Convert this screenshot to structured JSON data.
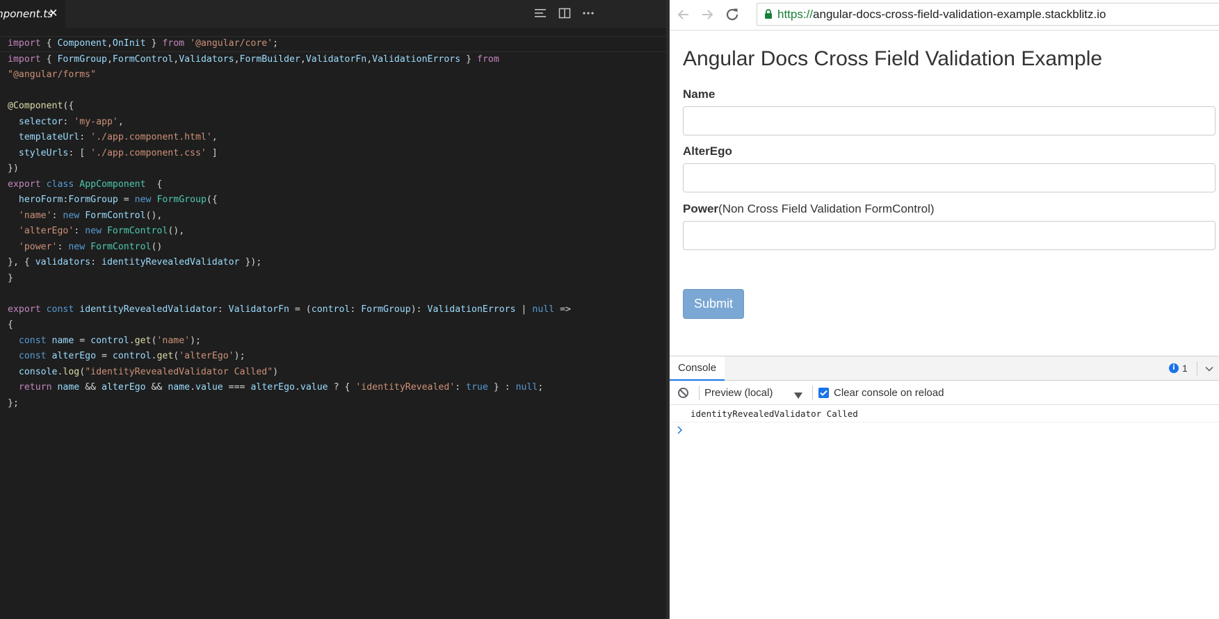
{
  "editor": {
    "tab_label": "app.component.ts",
    "tab_close": "✕",
    "icons": [
      "outline-icon",
      "split-editor-icon",
      "more-actions-icon"
    ],
    "code_lines": [
      [
        [
          "kw",
          "import"
        ],
        [
          "p",
          " { "
        ],
        [
          "ty",
          "Component"
        ],
        [
          "p",
          ","
        ],
        [
          "ty",
          "OnInit"
        ],
        [
          "p",
          " } "
        ],
        [
          "kw",
          "from"
        ],
        [
          "p",
          " "
        ],
        [
          "st",
          "'@angular/core'"
        ],
        [
          "p",
          ";"
        ]
      ],
      [
        [
          "kw",
          "import"
        ],
        [
          "p",
          " { "
        ],
        [
          "ty",
          "FormGroup"
        ],
        [
          "p",
          ","
        ],
        [
          "ty",
          "FormControl"
        ],
        [
          "p",
          ","
        ],
        [
          "ty",
          "Validators"
        ],
        [
          "p",
          ","
        ],
        [
          "ty",
          "FormBuilder"
        ],
        [
          "p",
          ","
        ],
        [
          "ty",
          "ValidatorFn"
        ],
        [
          "p",
          ","
        ],
        [
          "ty",
          "ValidationErrors"
        ],
        [
          "p",
          " } "
        ],
        [
          "kw",
          "from"
        ]
      ],
      [
        [
          "st",
          "\"@angular/forms\""
        ]
      ],
      [],
      [
        [
          "fn",
          "@Component"
        ],
        [
          "p",
          "({"
        ]
      ],
      [
        [
          "p",
          "  "
        ],
        [
          "pr",
          "selector"
        ],
        [
          "p",
          ": "
        ],
        [
          "st",
          "'my-app'"
        ],
        [
          "p",
          ","
        ]
      ],
      [
        [
          "p",
          "  "
        ],
        [
          "pr",
          "templateUrl"
        ],
        [
          "p",
          ": "
        ],
        [
          "st",
          "'./app.component.html'"
        ],
        [
          "p",
          ","
        ]
      ],
      [
        [
          "p",
          "  "
        ],
        [
          "pr",
          "styleUrls"
        ],
        [
          "p",
          ": [ "
        ],
        [
          "st",
          "'./app.component.css'"
        ],
        [
          "p",
          " ]"
        ]
      ],
      [
        [
          "p",
          "})"
        ]
      ],
      [
        [
          "kw",
          "export"
        ],
        [
          "p",
          " "
        ],
        [
          "bl",
          "class"
        ],
        [
          "p",
          " "
        ],
        [
          "cl",
          "AppComponent"
        ],
        [
          "p",
          "  {"
        ]
      ],
      [
        [
          "p",
          "  "
        ],
        [
          "pr",
          "heroForm"
        ],
        [
          "p",
          ":"
        ],
        [
          "ty",
          "FormGroup"
        ],
        [
          "p",
          " = "
        ],
        [
          "bl",
          "new"
        ],
        [
          "p",
          " "
        ],
        [
          "cl",
          "FormGroup"
        ],
        [
          "p",
          "({"
        ]
      ],
      [
        [
          "p",
          "  "
        ],
        [
          "st",
          "'name'"
        ],
        [
          "p",
          ": "
        ],
        [
          "bl",
          "new"
        ],
        [
          "p",
          " "
        ],
        [
          "ty",
          "FormControl"
        ],
        [
          "p",
          "(),"
        ]
      ],
      [
        [
          "p",
          "  "
        ],
        [
          "st",
          "'alterEgo'"
        ],
        [
          "p",
          ": "
        ],
        [
          "bl",
          "new"
        ],
        [
          "p",
          " "
        ],
        [
          "cl",
          "FormControl"
        ],
        [
          "p",
          "(),"
        ]
      ],
      [
        [
          "p",
          "  "
        ],
        [
          "st",
          "'power'"
        ],
        [
          "p",
          ": "
        ],
        [
          "bl",
          "new"
        ],
        [
          "p",
          " "
        ],
        [
          "cl",
          "FormControl"
        ],
        [
          "p",
          "()"
        ]
      ],
      [
        [
          "p",
          "}, { "
        ],
        [
          "pr",
          "validators"
        ],
        [
          "p",
          ": "
        ],
        [
          "pr",
          "identityRevealedValidator"
        ],
        [
          "p",
          " });"
        ]
      ],
      [
        [
          "p",
          "}"
        ]
      ],
      [],
      [
        [
          "kw",
          "export"
        ],
        [
          "p",
          " "
        ],
        [
          "bl",
          "const"
        ],
        [
          "p",
          " "
        ],
        [
          "pr",
          "identityRevealedValidator"
        ],
        [
          "p",
          ": "
        ],
        [
          "ty",
          "ValidatorFn"
        ],
        [
          "p",
          " = ("
        ],
        [
          "pr",
          "control"
        ],
        [
          "p",
          ": "
        ],
        [
          "ty",
          "FormGroup"
        ],
        [
          "p",
          "): "
        ],
        [
          "ty",
          "ValidationErrors"
        ],
        [
          "p",
          " | "
        ],
        [
          "bl",
          "null"
        ],
        [
          "p",
          " =>"
        ]
      ],
      [
        [
          "p",
          "{"
        ]
      ],
      [
        [
          "p",
          "  "
        ],
        [
          "bl",
          "const"
        ],
        [
          "p",
          " "
        ],
        [
          "pr",
          "name"
        ],
        [
          "p",
          " = "
        ],
        [
          "pr",
          "control"
        ],
        [
          "p",
          "."
        ],
        [
          "fn",
          "get"
        ],
        [
          "p",
          "("
        ],
        [
          "st",
          "'name'"
        ],
        [
          "p",
          ");"
        ]
      ],
      [
        [
          "p",
          "  "
        ],
        [
          "bl",
          "const"
        ],
        [
          "p",
          " "
        ],
        [
          "pr",
          "alterEgo"
        ],
        [
          "p",
          " = "
        ],
        [
          "pr",
          "control"
        ],
        [
          "p",
          "."
        ],
        [
          "fn",
          "get"
        ],
        [
          "p",
          "("
        ],
        [
          "st",
          "'alterEgo'"
        ],
        [
          "p",
          ");"
        ]
      ],
      [
        [
          "p",
          "  "
        ],
        [
          "pr",
          "console"
        ],
        [
          "p",
          "."
        ],
        [
          "fn",
          "log"
        ],
        [
          "p",
          "("
        ],
        [
          "st",
          "\"identityRevealedValidator Called\""
        ],
        [
          "p",
          ")"
        ]
      ],
      [
        [
          "p",
          "  "
        ],
        [
          "kw",
          "return"
        ],
        [
          "p",
          " "
        ],
        [
          "pr",
          "name"
        ],
        [
          "p",
          " && "
        ],
        [
          "pr",
          "alterEgo"
        ],
        [
          "p",
          " && "
        ],
        [
          "pr",
          "name"
        ],
        [
          "p",
          "."
        ],
        [
          "pr",
          "value"
        ],
        [
          "p",
          " === "
        ],
        [
          "pr",
          "alterEgo"
        ],
        [
          "p",
          "."
        ],
        [
          "pr",
          "value"
        ],
        [
          "p",
          " ? { "
        ],
        [
          "st",
          "'identityRevealed'"
        ],
        [
          "p",
          ": "
        ],
        [
          "bl",
          "true"
        ],
        [
          "p",
          " } : "
        ],
        [
          "bl",
          "null"
        ],
        [
          "p",
          ";"
        ]
      ],
      [
        [
          "p",
          "};"
        ]
      ]
    ],
    "colors": {
      "kw": "#c586c0",
      "p": "#d4d4d4",
      "ty": "#9cdcfe",
      "st": "#ce9178",
      "fn": "#dcdcaa",
      "pr": "#9cdcfe",
      "bl": "#569cd6",
      "cl": "#4ec9b0"
    }
  },
  "browser": {
    "icons": [
      "back-icon",
      "forward-icon",
      "reload-icon",
      "lock-icon"
    ],
    "url_scheme": "https://",
    "url_host": "angular-docs-cross-field-validation-example.stackblitz.io",
    "app": {
      "title": "Angular Docs Cross Field Validation Example",
      "name_label": "Name",
      "alter_ego_label": "AlterEgo",
      "power_label": "Power",
      "power_note": "(Non Cross Field Validation FormControl)",
      "name_value": "",
      "alter_ego_value": "",
      "power_value": "",
      "submit_label": "Submit"
    },
    "console": {
      "tab_label": "Console",
      "info_count": "1",
      "context": "Preview (local)",
      "clear_on_reload_label": "Clear console on reload",
      "clear_on_reload_checked": true,
      "log_message": "identityRevealedValidator Called"
    }
  }
}
